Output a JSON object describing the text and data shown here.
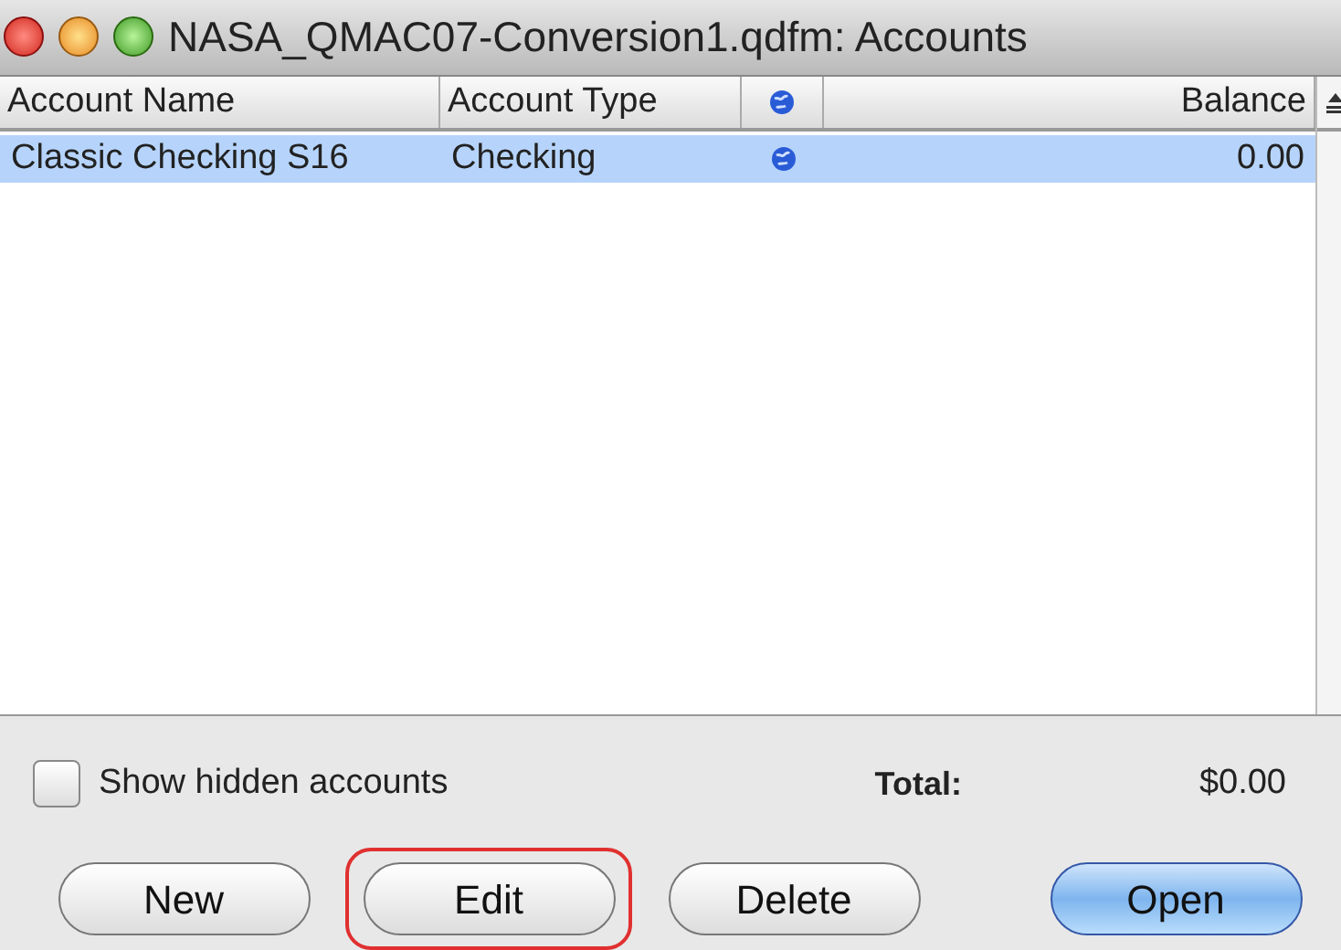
{
  "window": {
    "title": "NASA_QMAC07-Conversion1.qdfm: Accounts"
  },
  "table": {
    "columns": [
      {
        "label": "Account Name",
        "kind": "text"
      },
      {
        "label": "Account Type",
        "kind": "text"
      },
      {
        "kind": "globe"
      },
      {
        "label": "Balance",
        "kind": "number"
      }
    ],
    "rows": [
      {
        "selected": true,
        "cells": [
          "Classic Checking S16",
          "Checking",
          "",
          "0.00"
        ]
      }
    ]
  },
  "show_hidden": {
    "label": "Show hidden accounts",
    "checked": false
  },
  "total": {
    "label": "Total:",
    "value": "$0.00"
  },
  "buttons": [
    {
      "label": "New",
      "default": false,
      "highlighted": false
    },
    {
      "label": "Edit",
      "default": false,
      "highlighted": true
    },
    {
      "label": "Delete",
      "default": false,
      "highlighted": false
    },
    {
      "label": "Open",
      "default": true,
      "highlighted": false
    }
  ]
}
